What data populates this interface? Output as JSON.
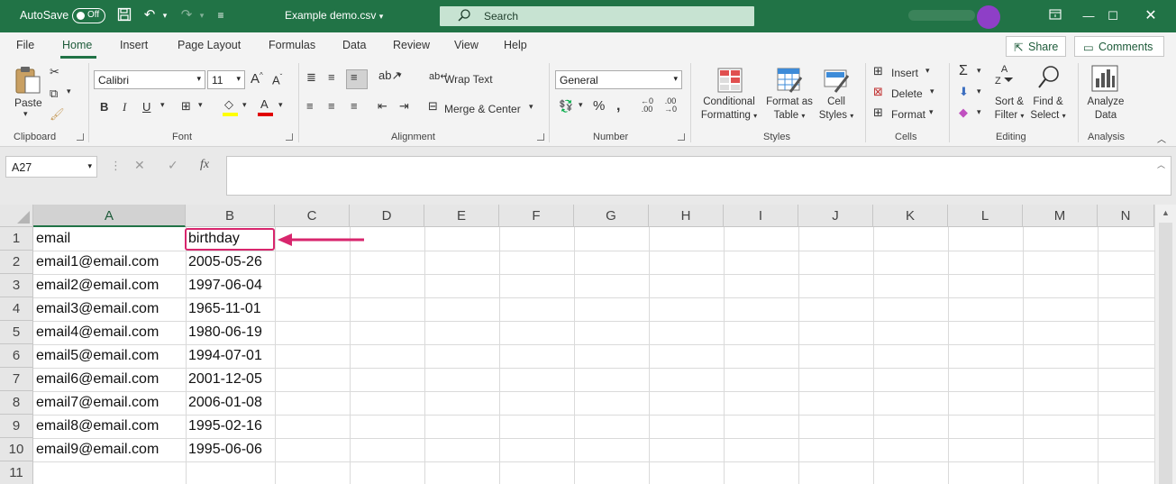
{
  "titlebar": {
    "autosave_label": "AutoSave",
    "autosave_state": "Off",
    "filename": "Example demo.csv",
    "search_placeholder": "Search"
  },
  "tabs": [
    "File",
    "Home",
    "Insert",
    "Page Layout",
    "Formulas",
    "Data",
    "Review",
    "View",
    "Help"
  ],
  "active_tab": "Home",
  "share_label": "Share",
  "comments_label": "Comments",
  "ribbon": {
    "clipboard": {
      "label": "Clipboard",
      "paste": "Paste"
    },
    "font": {
      "label": "Font",
      "name": "Calibri",
      "size": "11"
    },
    "alignment": {
      "label": "Alignment",
      "wrap_text": "Wrap Text",
      "merge_center": "Merge & Center"
    },
    "number": {
      "label": "Number",
      "format": "General"
    },
    "styles": {
      "label": "Styles",
      "conditional_1": "Conditional",
      "conditional_2": "Formatting",
      "format_table_1": "Format as",
      "format_table_2": "Table",
      "cell_styles_1": "Cell",
      "cell_styles_2": "Styles"
    },
    "cells": {
      "label": "Cells",
      "insert": "Insert",
      "delete": "Delete",
      "format": "Format"
    },
    "editing": {
      "label": "Editing",
      "sort_1": "Sort &",
      "sort_2": "Filter",
      "find_1": "Find &",
      "find_2": "Select"
    },
    "analysis": {
      "label": "Analysis",
      "analyze_1": "Analyze",
      "analyze_2": "Data"
    }
  },
  "formula_bar": {
    "name_box": "A27",
    "formula": ""
  },
  "sheet": {
    "columns": [
      "A",
      "B",
      "C",
      "D",
      "E",
      "F",
      "G",
      "H",
      "I",
      "J",
      "K",
      "L",
      "M",
      "N"
    ],
    "rows": [
      "1",
      "2",
      "3",
      "4",
      "5",
      "6",
      "7",
      "8",
      "9",
      "10",
      "11"
    ],
    "data": [
      [
        "email",
        "birthday"
      ],
      [
        "email1@email.com",
        "2005-05-26"
      ],
      [
        "email2@email.com",
        "1997-06-04"
      ],
      [
        "email3@email.com",
        "1965-11-01"
      ],
      [
        "email4@email.com",
        "1980-06-19"
      ],
      [
        "email5@email.com",
        "1994-07-01"
      ],
      [
        "email6@email.com",
        "2001-12-05"
      ],
      [
        "email7@email.com",
        "2006-01-08"
      ],
      [
        "email8@email.com",
        "1995-02-16"
      ],
      [
        "email9@email.com",
        "1995-06-06"
      ]
    ]
  },
  "colors": {
    "accent": "#217346",
    "highlight": "#d8266d"
  }
}
